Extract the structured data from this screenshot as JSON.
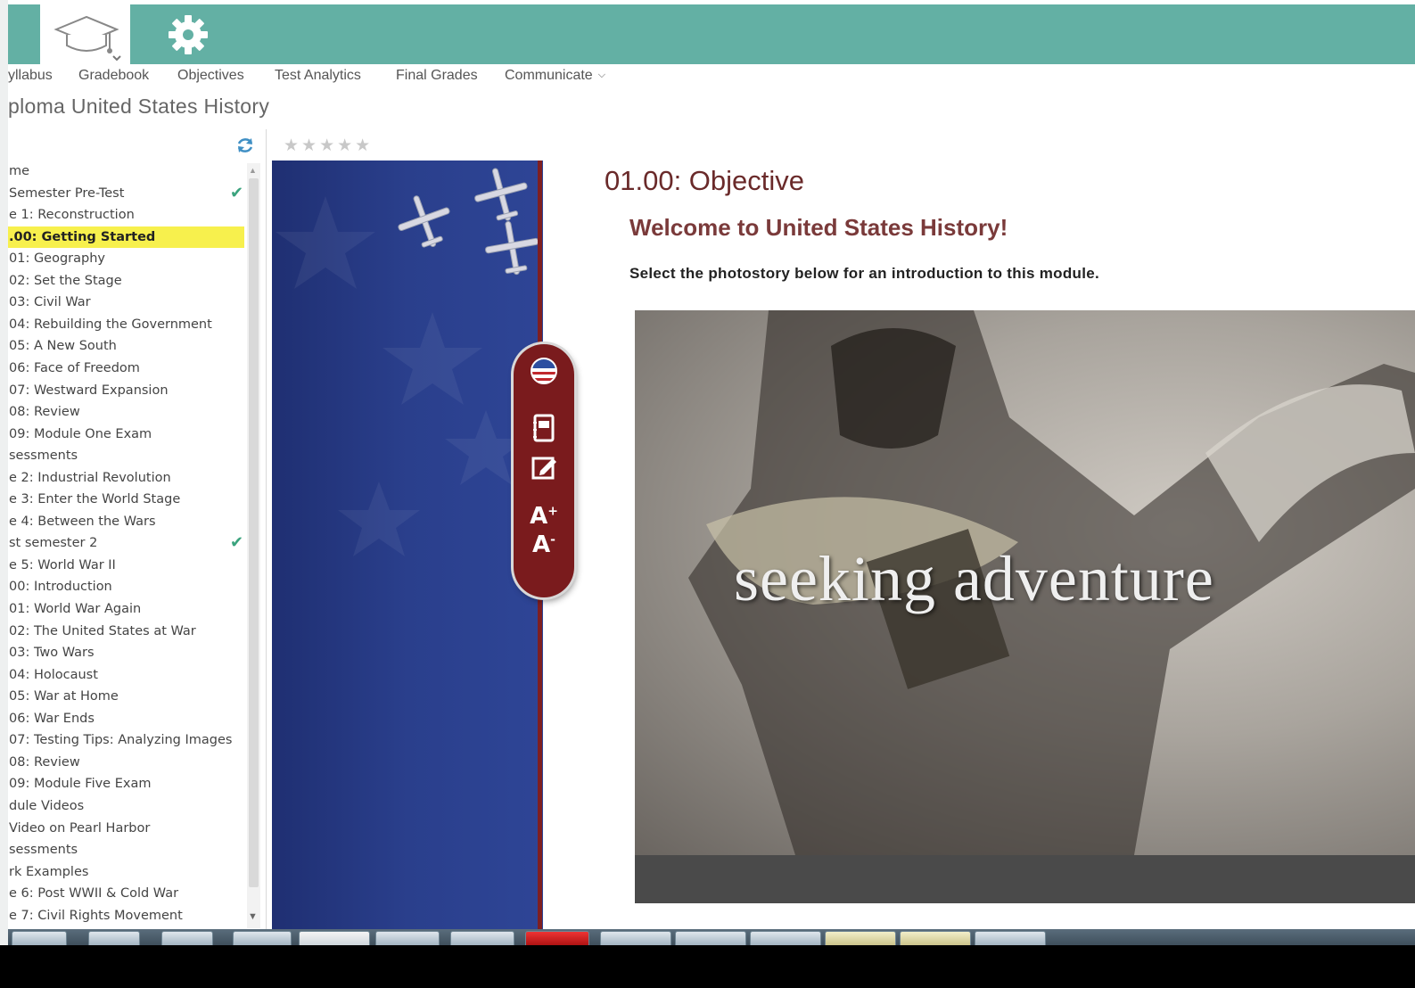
{
  "header": {
    "accent_color": "#63b0a4",
    "home_icon": "graduation-cap-icon",
    "settings_icon": "gear-icon"
  },
  "nav": {
    "items": [
      "yllabus",
      "Gradebook",
      "Objectives",
      "Test Analytics",
      "Final Grades",
      "Communicate"
    ],
    "communicate_icon": "chevron-down-icon"
  },
  "course": {
    "title": "ploma United States History"
  },
  "rating": {
    "stars": "★★★★★",
    "value": 0,
    "max": 5
  },
  "outline": {
    "items": [
      {
        "label": "me"
      },
      {
        "label": "Semester Pre-Test",
        "completed": true
      },
      {
        "label": "e 1: Reconstruction"
      },
      {
        "label": ".00: Getting Started",
        "active": true
      },
      {
        "label": "01: Geography"
      },
      {
        "label": "02: Set the Stage"
      },
      {
        "label": "03: Civil War"
      },
      {
        "label": "04: Rebuilding the Government"
      },
      {
        "label": "05: A New South"
      },
      {
        "label": "06: Face of Freedom"
      },
      {
        "label": "07: Westward Expansion"
      },
      {
        "label": "08: Review"
      },
      {
        "label": "09: Module One Exam"
      },
      {
        "label": "sessments"
      },
      {
        "label": "e 2: Industrial Revolution"
      },
      {
        "label": "e 3: Enter the World Stage"
      },
      {
        "label": "e 4: Between the Wars"
      },
      {
        "label": "st semester 2",
        "completed": true
      },
      {
        "label": "e 5: World War II"
      },
      {
        "label": "00: Introduction"
      },
      {
        "label": "01: World War Again"
      },
      {
        "label": "02: The United States at War"
      },
      {
        "label": "03: Two Wars"
      },
      {
        "label": "04: Holocaust"
      },
      {
        "label": "05: War at Home"
      },
      {
        "label": "06: War Ends"
      },
      {
        "label": "07: Testing Tips: Analyzing Images"
      },
      {
        "label": "08: Review"
      },
      {
        "label": "09: Module Five Exam"
      },
      {
        "label": "dule Videos"
      },
      {
        "label": "Video on Pearl Harbor"
      },
      {
        "label": "sessments"
      },
      {
        "label": "rk Examples"
      },
      {
        "label": "e 6: Post WWII & Cold War"
      },
      {
        "label": "e 7: Civil Rights Movement"
      }
    ],
    "check_glyph": "✔",
    "highlight_color": "#f7f04d"
  },
  "toolbar": {
    "icons": [
      "flag-icon",
      "notebook-icon",
      "edit-note-icon",
      "font-increase-icon",
      "font-decrease-icon"
    ],
    "color": "#7a1b1d"
  },
  "content": {
    "heading": "01.00: Objective",
    "subheading": "Welcome to United States History!",
    "instruction": "Select the photostory below for an introduction to this module.",
    "photostory_caption": "seeking adventure"
  }
}
